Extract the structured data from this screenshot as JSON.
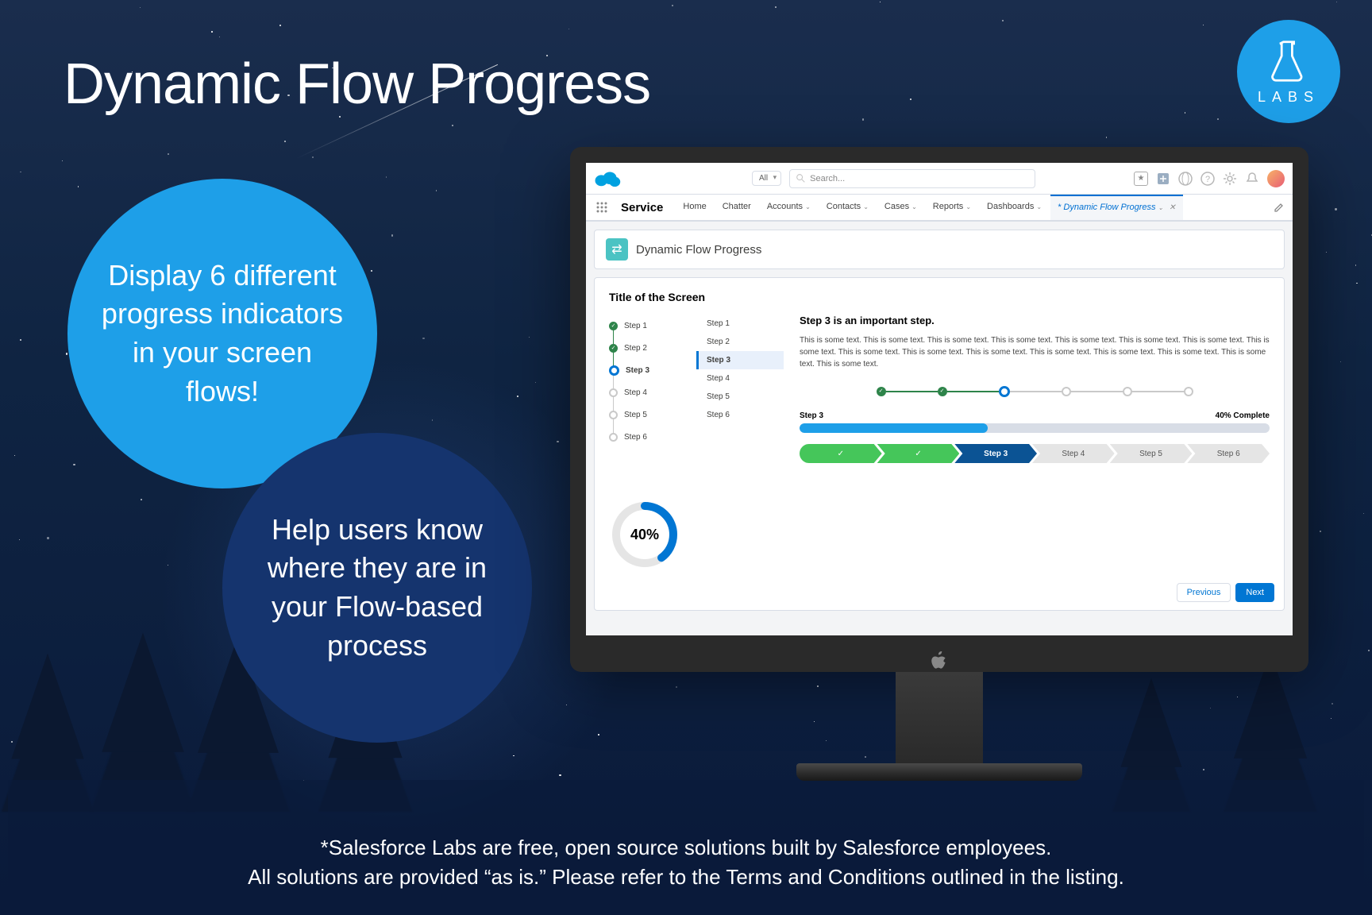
{
  "title": "Dynamic Flow Progress",
  "labs": {
    "text": "LABS"
  },
  "circle1": "Display 6 different progress indicators in your screen flows!",
  "circle2": "Help users know where they are in your Flow-based process",
  "footer": {
    "line1": "*Salesforce Labs are free, open source solutions built by Salesforce employees.",
    "line2": "All solutions are provided “as is.” Please refer to the Terms and Conditions outlined in the listing."
  },
  "sf": {
    "picker": "All",
    "search_placeholder": "Search...",
    "app_name": "Service",
    "tabs": [
      {
        "label": "Home",
        "dropdown": false
      },
      {
        "label": "Chatter",
        "dropdown": false
      },
      {
        "label": "Accounts",
        "dropdown": true
      },
      {
        "label": "Contacts",
        "dropdown": true
      },
      {
        "label": "Cases",
        "dropdown": true
      },
      {
        "label": "Reports",
        "dropdown": true
      },
      {
        "label": "Dashboards",
        "dropdown": true
      }
    ],
    "active_tab": "* Dynamic Flow Progress",
    "header_card": "Dynamic Flow Progress",
    "card_title": "Title of the Screen",
    "steps": [
      "Step 1",
      "Step 2",
      "Step 3",
      "Step 4",
      "Step 5",
      "Step 6"
    ],
    "current_step_index": 2,
    "main_heading": "Step 3 is an important step.",
    "main_text": "This is some text. This is some text. This is some text. This is some text. This is some text. This is some text. This is some text. This is some text. This is some text. This is some text. This is some text. This is some text. This is some text. This is some text. This is some text. This is some text.",
    "bar": {
      "left": "Step 3",
      "right": "40% Complete",
      "percent": 40
    },
    "ring": {
      "label": "40%",
      "percent": 40
    },
    "buttons": {
      "prev": "Previous",
      "next": "Next"
    }
  }
}
